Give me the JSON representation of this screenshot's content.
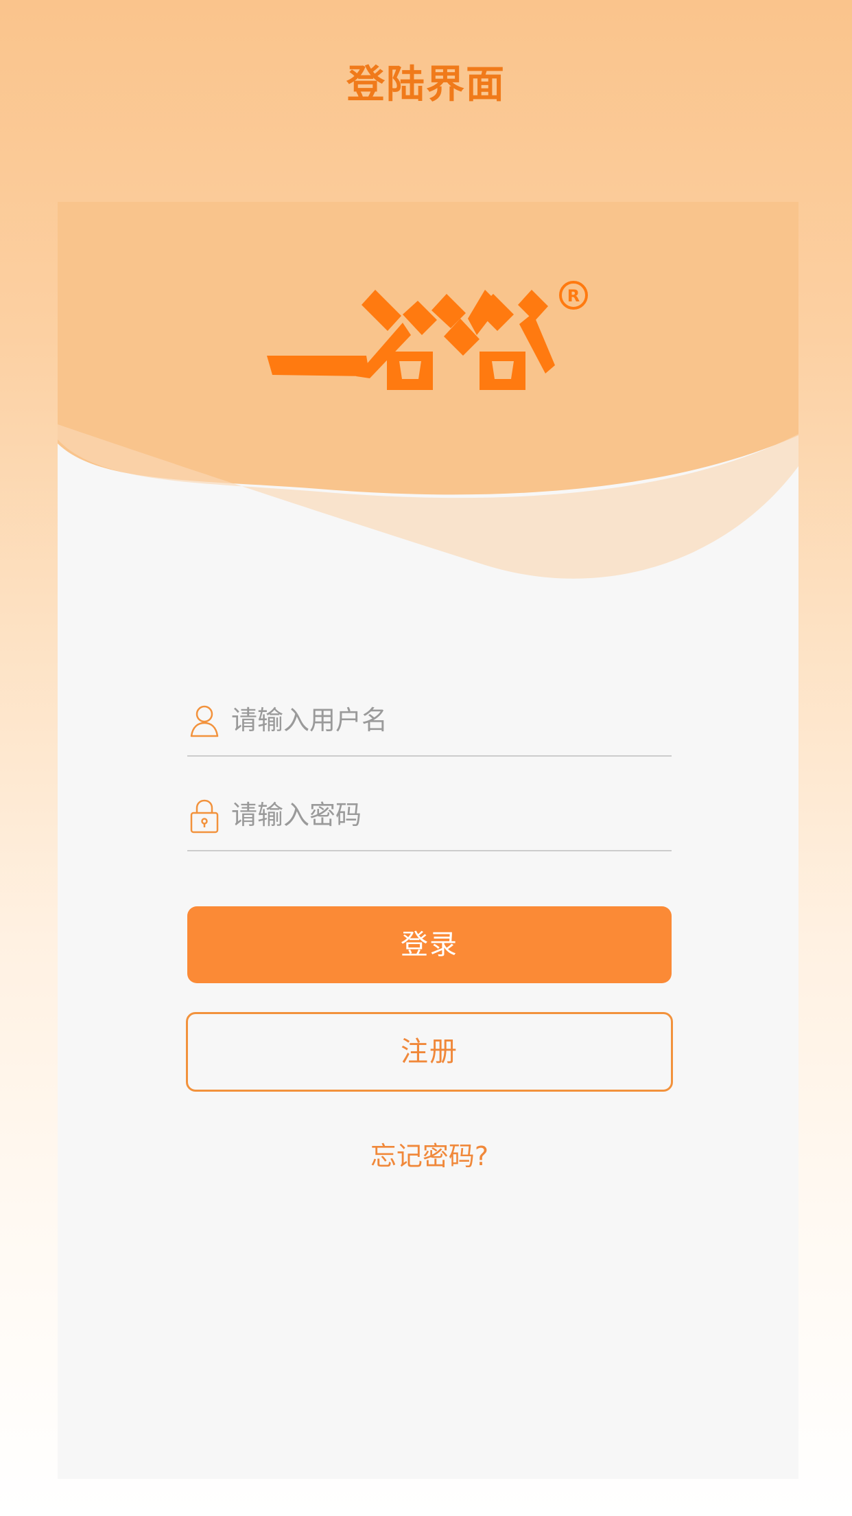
{
  "page": {
    "title": "登陆界面"
  },
  "brand": {
    "logo_text": "一谷谷",
    "registered_mark": "®"
  },
  "form": {
    "username_placeholder": "请输入用户名",
    "username_value": "",
    "password_placeholder": "请输入密码",
    "password_value": ""
  },
  "buttons": {
    "login_label": "登录",
    "register_label": "注册",
    "forgot_label": "忘记密码?"
  },
  "icons": {
    "user": "user-icon",
    "lock": "lock-icon"
  },
  "colors": {
    "accent": "#fb8a36",
    "title": "#f07a1a",
    "outline": "#f2923c",
    "header_bg": "#f9c48c",
    "card_bg": "#f7f7f7",
    "placeholder": "#9a9a9a"
  }
}
